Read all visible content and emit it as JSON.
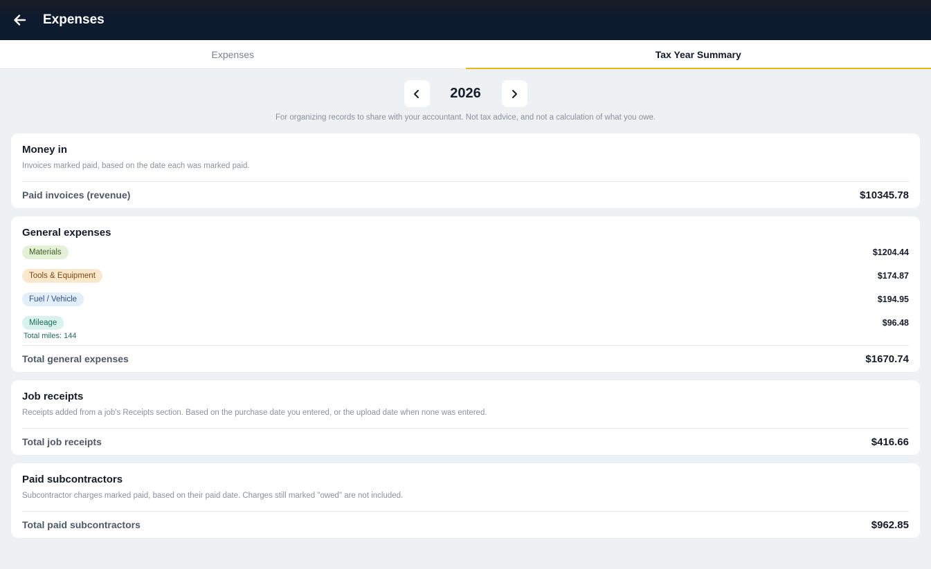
{
  "header": {
    "title": "Expenses"
  },
  "tabs": [
    {
      "label": "Expenses",
      "active": false
    },
    {
      "label": "Tax Year Summary",
      "active": true
    }
  ],
  "year_selector": {
    "year": "2026"
  },
  "disclaimer": "For organizing records to share with your accountant. Not tax advice, and not a calculation of what you owe.",
  "money_in": {
    "title": "Money in",
    "description": "Invoices marked paid, based on the date each was marked paid.",
    "total_label": "Paid invoices (revenue)",
    "total_value": "$10345.78"
  },
  "general_expenses": {
    "title": "General expenses",
    "categories": [
      {
        "label": "Materials",
        "value": "$1204.44",
        "color": "#e4f1d7"
      },
      {
        "label": "Tools & Equipment",
        "value": "$174.87",
        "color": "#fbe7cc"
      },
      {
        "label": "Fuel / Vehicle",
        "value": "$194.95",
        "color": "#e3eefb"
      },
      {
        "label": "Mileage",
        "value": "$96.48",
        "color": "#d9f2ec",
        "note": "Total miles: 144"
      }
    ],
    "total_label": "Total general expenses",
    "total_value": "$1670.74"
  },
  "job_receipts": {
    "title": "Job receipts",
    "description": "Receipts added from a job's Receipts section. Based on the purchase date you entered, or the upload date when none was entered.",
    "total_label": "Total job receipts",
    "total_value": "$416.66"
  },
  "subcontractors": {
    "title": "Paid subcontractors",
    "description": "Subcontractor charges marked paid, based on their paid date. Charges still marked \"owed\" are not included.",
    "total_label": "Total paid subcontractors",
    "total_value": "$962.85"
  },
  "icons": {
    "back": "arrow-left-icon",
    "prev_year": "chevron-left-icon",
    "next_year": "chevron-right-icon"
  },
  "colors": {
    "accent": "#e5b818",
    "header_bg": "#0c1b2f"
  }
}
